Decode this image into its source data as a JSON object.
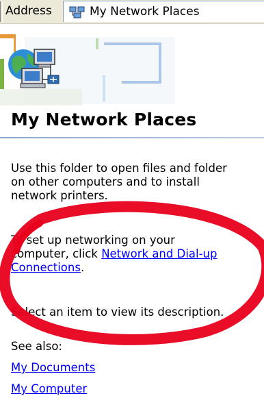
{
  "address_bar": {
    "label": "Address",
    "value": "My Network Places",
    "icon": "network-places-icon"
  },
  "page": {
    "title": "My Network Places",
    "banner_icon": "network-computers-icon",
    "intro_lines": [
      "Use this folder to open files and folder",
      "on other computers and to install",
      "network printers."
    ],
    "setup": {
      "line1": "To set up networking on your",
      "line2_prefix": "computer, click ",
      "link_part1": "Network and Dial-up",
      "link_part2": "Connections",
      "line3_suffix": "."
    },
    "description_hint": "Select an item to view its description.",
    "see_also_label": "See also:",
    "see_also_links": [
      "My Documents",
      "My Computer"
    ]
  },
  "annotation": {
    "shape": "hand-drawn ellipse",
    "color": "#e8001c"
  }
}
